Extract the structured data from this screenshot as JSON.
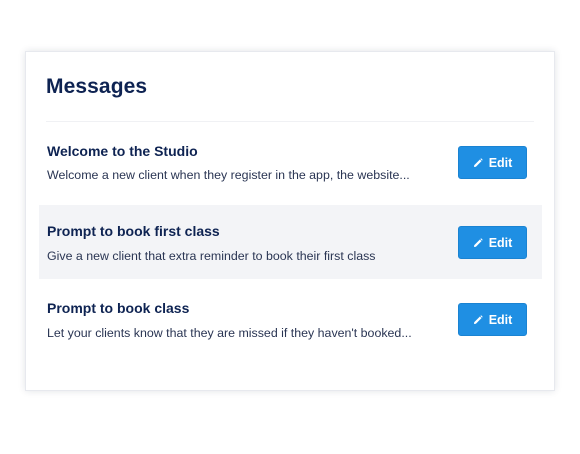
{
  "panel": {
    "title": "Messages"
  },
  "messages": [
    {
      "title": "Welcome to the Studio",
      "description": "Welcome a new client when they register in the app, the website...",
      "edit_label": "Edit",
      "edit_icon": "pencil-icon"
    },
    {
      "title": "Prompt to book first class",
      "description": "Give a new client that extra reminder to book their first class",
      "edit_label": "Edit",
      "edit_icon": "pencil-icon",
      "highlighted": true
    },
    {
      "title": "Prompt to book class",
      "description": "Let your clients know that they are missed if they haven't booked...",
      "edit_label": "Edit",
      "edit_icon": "pencil-icon"
    }
  ],
  "colors": {
    "heading": "#0e2352",
    "button": "#1f8fe3",
    "highlight_row": "#f3f4f7"
  }
}
